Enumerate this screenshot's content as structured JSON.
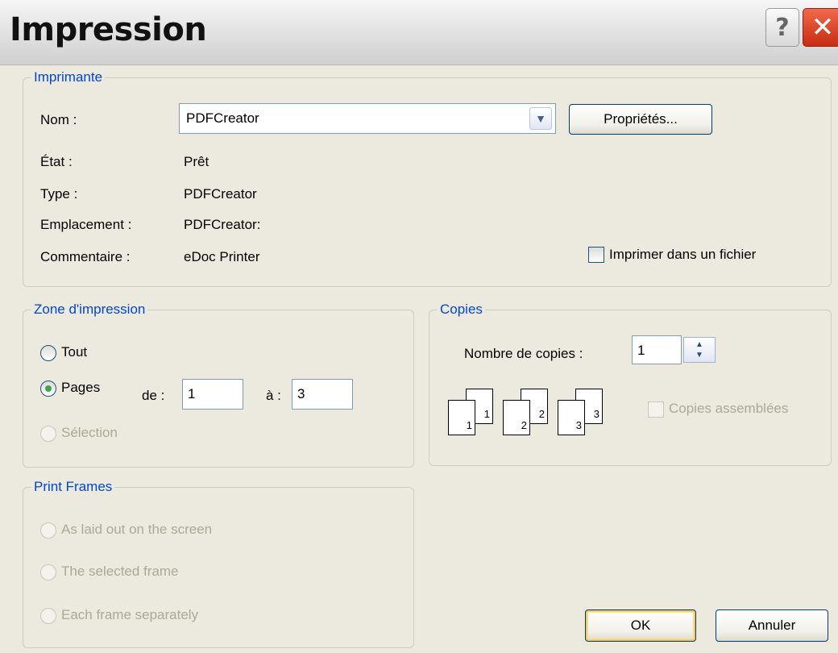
{
  "window": {
    "title": "Impression",
    "help_icon": "?",
    "close_icon": "✕"
  },
  "printer": {
    "legend": "Imprimante",
    "name_label": "Nom :",
    "name_value": "PDFCreator",
    "properties_button": "Propriétés...",
    "state_label": "État :",
    "state_value": "Prêt",
    "type_label": "Type :",
    "type_value": "PDFCreator",
    "location_label": "Emplacement :",
    "location_value": "PDFCreator:",
    "comment_label": "Commentaire :",
    "comment_value": "eDoc Printer",
    "print_to_file_label": "Imprimer dans un fichier",
    "print_to_file_checked": false
  },
  "range": {
    "legend": "Zone d'impression",
    "all_label": "Tout",
    "pages_label": "Pages",
    "from_label": "de :",
    "from_value": "1",
    "to_label": "à :",
    "to_value": "3",
    "selection_label": "Sélection",
    "selected": "pages"
  },
  "copies": {
    "legend": "Copies",
    "count_label": "Nombre de copies :",
    "count_value": "1",
    "collate_label": "Copies assemblées",
    "collate_enabled": false,
    "collate_pages": [
      "1",
      "1",
      "2",
      "2",
      "3",
      "3"
    ]
  },
  "frames": {
    "legend": "Print Frames",
    "option_layout": "As laid out on the screen",
    "option_selected": "The selected frame",
    "option_each": "Each frame separately",
    "enabled": false
  },
  "buttons": {
    "ok": "OK",
    "cancel": "Annuler"
  },
  "colors": {
    "accent": "#0046d5",
    "dialog_bg": "#eceade",
    "disabled_text": "#aca899",
    "close_red": "#d9431f"
  }
}
